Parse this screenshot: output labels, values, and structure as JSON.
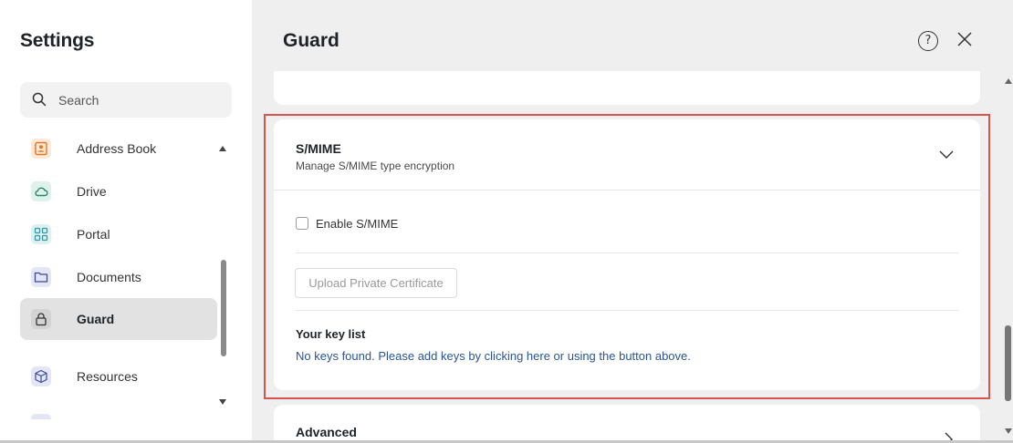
{
  "sidebar": {
    "title": "Settings",
    "search": {
      "placeholder": "Search"
    },
    "items": [
      {
        "label": "Address Book",
        "icon": "address-book-icon",
        "color": "#e87722",
        "bg": "#fde9d9"
      },
      {
        "label": "Drive",
        "icon": "cloud-icon",
        "color": "#1f8a70",
        "bg": "#dff2ea"
      },
      {
        "label": "Portal",
        "icon": "grid-icon",
        "color": "#2f9aa8",
        "bg": "#ddf1f3"
      },
      {
        "label": "Documents",
        "icon": "folder-icon",
        "color": "#3b4a9a",
        "bg": "#e3e6f5"
      },
      {
        "label": "Guard",
        "icon": "lock-icon",
        "color": "#333333",
        "bg": "#d3d3d3",
        "active": true
      },
      {
        "label": "Resources",
        "icon": "cube-icon",
        "color": "#3b4a9a",
        "bg": "#e3e6f5"
      }
    ]
  },
  "main": {
    "title": "Guard",
    "help_icon": "help-icon",
    "close_icon": "close-icon",
    "smime": {
      "title": "S/MIME",
      "subtitle": "Manage S/MIME type encryption",
      "enable_label": "Enable S/MIME",
      "enabled": false,
      "upload_label": "Upload Private Certificate",
      "keylist_title": "Your key list",
      "keylist_empty": "No keys found. Please add keys by clicking here or using the button above."
    },
    "advanced": {
      "title": "Advanced"
    }
  },
  "colors": {
    "highlight": "#d9534f",
    "link": "#2a5596",
    "pane_bg": "#efefef"
  }
}
